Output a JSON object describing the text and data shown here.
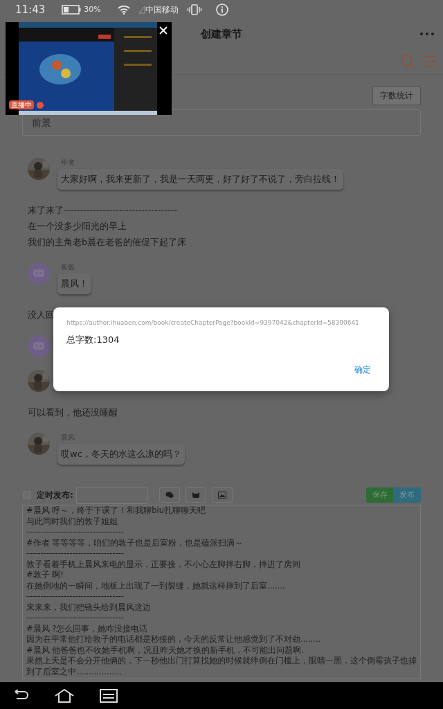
{
  "status_bar": {
    "time": "11:43",
    "battery": "30%",
    "carrier": "中国移动"
  },
  "header": {
    "title": "创建章节"
  },
  "live_overlay": {
    "badge": "直播中"
  },
  "word_count_button": "字数统计",
  "chapter_title_field": {
    "value": "前景"
  },
  "chat": [
    {
      "kind": "message",
      "bot": false,
      "speaker": "作者",
      "text": "大家好啊，我来更新了，我是一天两更，好了好了不说了，旁白拉线！"
    },
    {
      "kind": "narration",
      "lines": [
        "来了来了-----------------------------------",
        "在一个没多少阳光的早上",
        "我们的主角老b晨在老爸的催促下起了床"
      ]
    },
    {
      "kind": "message",
      "bot": true,
      "speaker": "爸爸",
      "text": "晨风！"
    },
    {
      "kind": "narration",
      "lines": [
        "没人回"
      ]
    },
    {
      "kind": "message",
      "bot": true
    },
    {
      "kind": "message",
      "bot": false
    },
    {
      "kind": "narration",
      "lines": [
        "可以看到，他还没睡醒"
      ]
    },
    {
      "kind": "message",
      "bot": false,
      "speaker": "晨风",
      "text": "哎wc，冬天的水这么凉的吗？"
    }
  ],
  "publish_bar": {
    "schedule_checked": false,
    "schedule_label": "定时发布:",
    "save": "保存",
    "publish": "发布"
  },
  "editor_lines": [
    "#晨风 呼～，终于下课了！和我聊biu扎聊聊天吧",
    "与此同时我们的敦子姐姐",
    "----------------------------------",
    "#作者 等等等等，咱们的敦子也是后室粉，也是磕派扫滴～",
    "----------------------------------",
    "敦子看着手机上晨风来电的显示，正要接，不小心左脚拌右脚，摔进了房间",
    "#敦子 啊!",
    "在她倒地的一瞬间，地板上出现了一到裂缝，她就这样摔到了后室.......",
    "----------------------------------",
    "来来来，我们把镜头给到晨风这边",
    "----------------------------------",
    "#晨风 ?怎么回事，她咋没接电话",
    "因为在平常他打给敦子的电话都是秒接的，今天的反常让他感觉到了不对劲........",
    "#晨风 他爸爸也不收她手机啊，况且昨天她才换的新手机，不可能出问题啊.",
    "果然上天是不会分开他俩的，下一秒他出门打算找她的时候就绊倒在门槛上，眼睛一黑，这个倒霉孩子也掉到了后室之中.................."
  ],
  "dialog": {
    "url": "https://author.ihuaben.com/book/createChapterPage?bookId=9397042&chapterId=58300641",
    "message": "总字数:1304",
    "ok": "确定"
  }
}
